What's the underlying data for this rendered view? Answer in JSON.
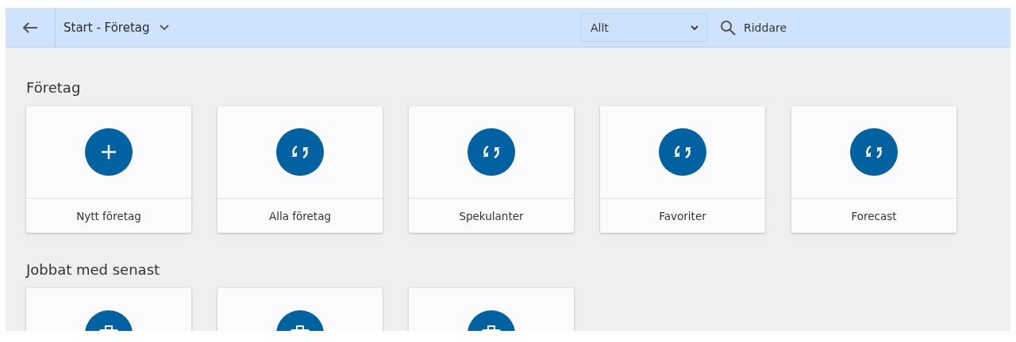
{
  "header": {
    "title": "Start - Företag",
    "filter": {
      "value": "Allt"
    },
    "search": {
      "value": "Riddare"
    }
  },
  "sections": [
    {
      "title": "Företag",
      "tiles": [
        {
          "label": "Nytt företag",
          "kind": "plus"
        },
        {
          "label": "Alla företag",
          "kind": "sync"
        },
        {
          "label": "Spekulanter",
          "kind": "sync"
        },
        {
          "label": "Favoriter",
          "kind": "sync"
        },
        {
          "label": "Forecast",
          "kind": "sync"
        }
      ]
    },
    {
      "title": "Jobbat med senast",
      "tiles": [
        {
          "kind": "briefcase"
        },
        {
          "kind": "briefcase"
        },
        {
          "kind": "briefcase"
        }
      ]
    }
  ]
}
